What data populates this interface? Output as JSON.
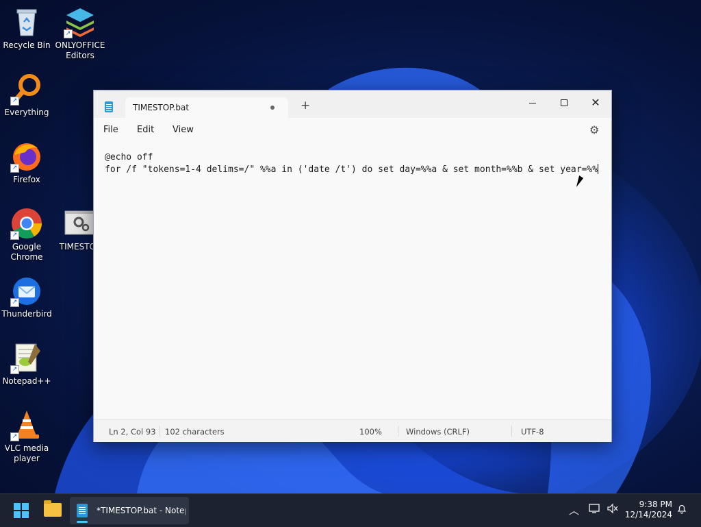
{
  "desktop": {
    "icons": [
      {
        "label": "Recycle Bin",
        "icon": "recycle-bin-icon"
      },
      {
        "label": "ONLYOFFICE Editors",
        "icon": "onlyoffice-icon"
      },
      {
        "label": "Everything",
        "icon": "everything-search-icon"
      },
      {
        "label": "Firefox",
        "icon": "firefox-icon"
      },
      {
        "label": "Google Chrome",
        "icon": "chrome-icon"
      },
      {
        "label": "TIMESTOP",
        "icon": "batch-file-gear-icon"
      },
      {
        "label": "Thunderbird",
        "icon": "thunderbird-icon"
      },
      {
        "label": "Notepad++",
        "icon": "notepadpp-icon"
      },
      {
        "label": "VLC media player",
        "icon": "vlc-icon"
      }
    ]
  },
  "notepad": {
    "tab_title": "TIMESTOP.bat",
    "new_tab": "+",
    "window_controls": {
      "close": "✕"
    },
    "menu": {
      "file": "File",
      "edit": "Edit",
      "view": "View"
    },
    "content": {
      "line1": "@echo off",
      "line2": "for /f \"tokens=1-4 delims=/\" %%a in ('date /t') do set day=%%a & set month=%%b & set year=%%"
    },
    "status": {
      "position": "Ln 2, Col 93",
      "characters": "102 characters",
      "zoom": "100%",
      "line_ending": "Windows (CRLF)",
      "encoding": "UTF-8"
    }
  },
  "taskbar": {
    "active_app_label": "*TIMESTOP.bat - Notepad",
    "clock_time": "9:38 PM",
    "clock_date": "12/14/2024"
  },
  "colors": {
    "accent": "#4cc2ff",
    "taskbar": "#1c2230",
    "window_bg": "#f9f9f9"
  }
}
